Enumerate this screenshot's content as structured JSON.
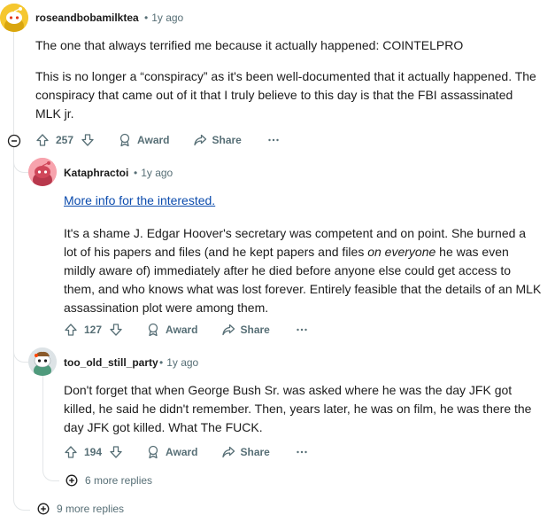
{
  "comments": [
    {
      "username": "roseandbobamilktea",
      "time": "1y ago",
      "paragraphs": [
        "The one that always terrified me because it actually happened: COINTELPRO",
        "This is no longer a “conspiracy” as it's been well-documented that it actually happened. The conspiracy that came out of it that I truly believe to this day is that the FBI assassinated MLK jr."
      ],
      "votes": "257",
      "award_label": "Award",
      "share_label": "Share",
      "more_replies": "9 more replies"
    },
    {
      "username": "Kataphractoi",
      "time": "1y ago",
      "link_text": "More info for the interested.",
      "paragraph_before_em": "It's a shame J. Edgar Hoover's secretary was competent and on point. She burned a lot of his papers and files (and he kept papers and files ",
      "emphasis": "on everyone",
      "paragraph_after_em": " he was even mildly aware of) immediately after he died before anyone else could get access to them, and who knows what was lost forever. Entirely feasible that the details of an MLK assassination plot were among them.",
      "votes": "127",
      "award_label": "Award",
      "share_label": "Share"
    },
    {
      "username": "too_old_still_party",
      "time": "1y ago",
      "paragraphs": [
        "Don't forget that when George Bush Sr. was asked where he was the day JFK got killed, he said he didn't remember. Then, years later, he was on film, he was there the day JFK got killed. What The FUCK."
      ],
      "votes": "194",
      "award_label": "Award",
      "share_label": "Share",
      "more_replies": "6 more replies"
    }
  ],
  "colors": {
    "text": "#1c1c1c",
    "meta": "#576f76",
    "link": "#0b4bad",
    "thread_line": "#e3e6e8",
    "avatar_yellow": "#f5c72f",
    "avatar_pink": "#f7a3ad",
    "avatar_gray": "#dde3e6"
  }
}
